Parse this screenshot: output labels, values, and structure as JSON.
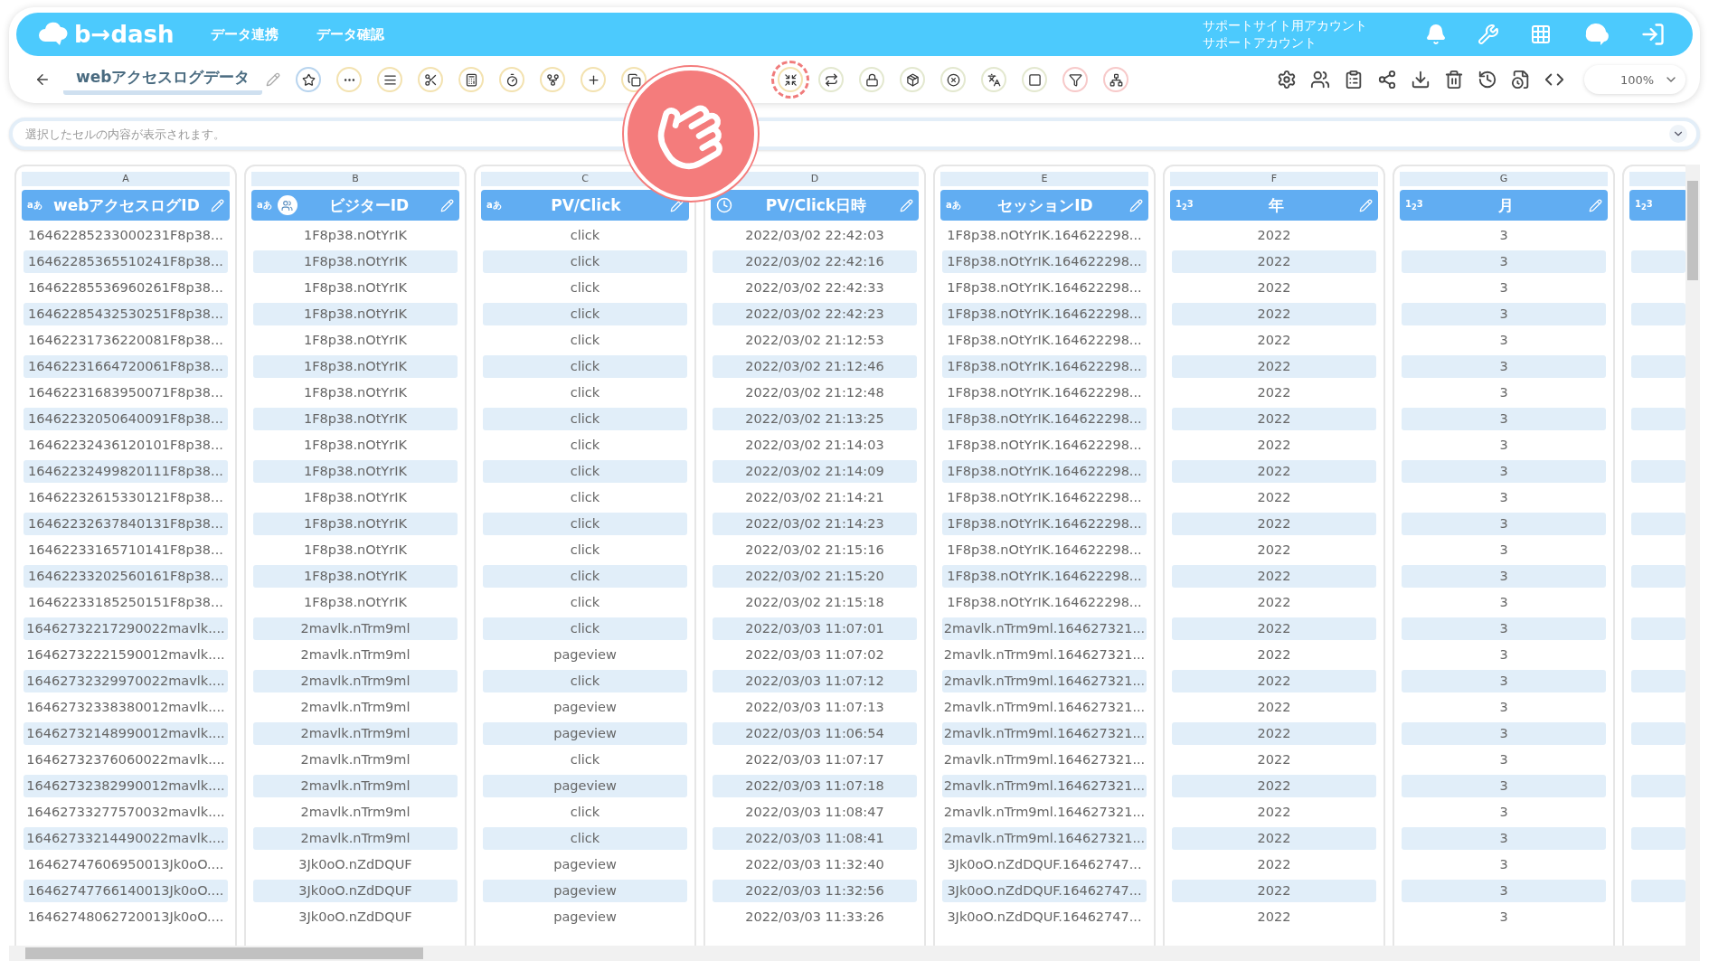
{
  "header": {
    "logo": "b→dash",
    "nav": [
      {
        "label": "データ連携"
      },
      {
        "label": "データ確認"
      }
    ],
    "account": [
      "サポートサイト用アカウント",
      "サポートアカウント"
    ]
  },
  "toolbar": {
    "title": "webアクセスログデータ",
    "tools": [
      {
        "color": "#b8d4ee",
        "highlighted": false
      },
      {
        "color": "#f3e2b0",
        "highlighted": false
      },
      {
        "color": "#f3e2b0",
        "highlighted": false
      },
      {
        "color": "#f3e2b0",
        "highlighted": false
      },
      {
        "color": "#f3e2b0",
        "highlighted": false
      },
      {
        "color": "#f3e2b0",
        "highlighted": false
      },
      {
        "color": "#f3e2b0",
        "highlighted": false
      },
      {
        "color": "#f3e2b0",
        "highlighted": false
      },
      {
        "color": "#f3e2b0",
        "highlighted": false
      },
      {
        "color": "#f3e2b0",
        "highlighted": true
      },
      {
        "color": "#e3e8cf",
        "highlighted": false
      },
      {
        "color": "#e3e8cf",
        "highlighted": false
      },
      {
        "color": "#e3e8cf",
        "highlighted": false
      },
      {
        "color": "#e3e8cf",
        "highlighted": false
      },
      {
        "color": "#e3e8cf",
        "highlighted": false
      },
      {
        "color": "#e3e8cf",
        "highlighted": false
      },
      {
        "color": "#f7c9c9",
        "highlighted": false
      },
      {
        "color": "#f7c9c9",
        "highlighted": false
      }
    ],
    "zoom": "100%"
  },
  "formula_bar": {
    "placeholder": "選択したセルの内容が表示されます。"
  },
  "table": {
    "columns": [
      {
        "letter": "A",
        "kind": "text",
        "badge": "aあ",
        "title": "webアクセスログID",
        "cells": [
          "16462285233000231F8p38...",
          "16462285365510241F8p38...",
          "16462285536960261F8p38...",
          "16462285432530251F8p38...",
          "16462231736220081F8p38...",
          "16462231664720061F8p38...",
          "16462231683950071F8p38...",
          "16462232050640091F8p38...",
          "16462232436120101F8p38...",
          "16462232499820111F8p38...",
          "16462232615330121F8p38...",
          "16462232637840131F8p38...",
          "16462233165710141F8p38...",
          "16462233202560161F8p38...",
          "16462233185250151F8p38...",
          "16462732217290022mavlk....",
          "16462732221590012mavlk....",
          "16462732329970022mavlk....",
          "16462732338380012mavlk....",
          "16462732148990012mavlk....",
          "16462732376060022mavlk....",
          "16462732382990012mavlk....",
          "16462733277570032mavlk....",
          "16462733214490022mavlk....",
          "16462747606950013Jk0oO....",
          "16462747766140013Jk0oO....",
          "16462748062720013Jk0oO...."
        ]
      },
      {
        "letter": "B",
        "kind": "text",
        "badge": "aあ",
        "linked": true,
        "title": "ビジターID",
        "cells": [
          "1F8p38.nOtYrIK",
          "1F8p38.nOtYrIK",
          "1F8p38.nOtYrIK",
          "1F8p38.nOtYrIK",
          "1F8p38.nOtYrIK",
          "1F8p38.nOtYrIK",
          "1F8p38.nOtYrIK",
          "1F8p38.nOtYrIK",
          "1F8p38.nOtYrIK",
          "1F8p38.nOtYrIK",
          "1F8p38.nOtYrIK",
          "1F8p38.nOtYrIK",
          "1F8p38.nOtYrIK",
          "1F8p38.nOtYrIK",
          "1F8p38.nOtYrIK",
          "2mavlk.nTrm9ml",
          "2mavlk.nTrm9ml",
          "2mavlk.nTrm9ml",
          "2mavlk.nTrm9ml",
          "2mavlk.nTrm9ml",
          "2mavlk.nTrm9ml",
          "2mavlk.nTrm9ml",
          "2mavlk.nTrm9ml",
          "2mavlk.nTrm9ml",
          "3Jk0oO.nZdDQUF",
          "3Jk0oO.nZdDQUF",
          "3Jk0oO.nZdDQUF"
        ]
      },
      {
        "letter": "C",
        "kind": "text",
        "badge": "aあ",
        "title": "PV/Click",
        "cells": [
          "click",
          "click",
          "click",
          "click",
          "click",
          "click",
          "click",
          "click",
          "click",
          "click",
          "click",
          "click",
          "click",
          "click",
          "click",
          "click",
          "pageview",
          "click",
          "pageview",
          "pageview",
          "click",
          "pageview",
          "click",
          "click",
          "pageview",
          "pageview",
          "pageview"
        ]
      },
      {
        "letter": "D",
        "kind": "datetime",
        "title": "PV/Click日時",
        "cells": [
          "2022/03/02 22:42:03",
          "2022/03/02 22:42:16",
          "2022/03/02 22:42:33",
          "2022/03/02 22:42:23",
          "2022/03/02 21:12:53",
          "2022/03/02 21:12:46",
          "2022/03/02 21:12:48",
          "2022/03/02 21:13:25",
          "2022/03/02 21:14:03",
          "2022/03/02 21:14:09",
          "2022/03/02 21:14:21",
          "2022/03/02 21:14:23",
          "2022/03/02 21:15:16",
          "2022/03/02 21:15:20",
          "2022/03/02 21:15:18",
          "2022/03/03 11:07:01",
          "2022/03/03 11:07:02",
          "2022/03/03 11:07:12",
          "2022/03/03 11:07:13",
          "2022/03/03 11:06:54",
          "2022/03/03 11:07:17",
          "2022/03/03 11:07:18",
          "2022/03/03 11:08:47",
          "2022/03/03 11:08:41",
          "2022/03/03 11:32:40",
          "2022/03/03 11:32:56",
          "2022/03/03 11:33:26"
        ]
      },
      {
        "letter": "E",
        "kind": "text",
        "badge": "aあ",
        "title": "セッションID",
        "cells": [
          "1F8p38.nOtYrIK.164622298...",
          "1F8p38.nOtYrIK.164622298...",
          "1F8p38.nOtYrIK.164622298...",
          "1F8p38.nOtYrIK.164622298...",
          "1F8p38.nOtYrIK.164622298...",
          "1F8p38.nOtYrIK.164622298...",
          "1F8p38.nOtYrIK.164622298...",
          "1F8p38.nOtYrIK.164622298...",
          "1F8p38.nOtYrIK.164622298...",
          "1F8p38.nOtYrIK.164622298...",
          "1F8p38.nOtYrIK.164622298...",
          "1F8p38.nOtYrIK.164622298...",
          "1F8p38.nOtYrIK.164622298...",
          "1F8p38.nOtYrIK.164622298...",
          "1F8p38.nOtYrIK.164622298...",
          "2mavlk.nTrm9ml.164627321...",
          "2mavlk.nTrm9ml.164627321...",
          "2mavlk.nTrm9ml.164627321...",
          "2mavlk.nTrm9ml.164627321...",
          "2mavlk.nTrm9ml.164627321...",
          "2mavlk.nTrm9ml.164627321...",
          "2mavlk.nTrm9ml.164627321...",
          "2mavlk.nTrm9ml.164627321...",
          "2mavlk.nTrm9ml.164627321...",
          "3Jk0oO.nZdDQUF.16462747...",
          "3Jk0oO.nZdDQUF.16462747...",
          "3Jk0oO.nZdDQUF.16462747..."
        ]
      },
      {
        "letter": "F",
        "kind": "number",
        "badge": "1$_{2}$3",
        "title": "年",
        "cells": [
          "2022",
          "2022",
          "2022",
          "2022",
          "2022",
          "2022",
          "2022",
          "2022",
          "2022",
          "2022",
          "2022",
          "2022",
          "2022",
          "2022",
          "2022",
          "2022",
          "2022",
          "2022",
          "2022",
          "2022",
          "2022",
          "2022",
          "2022",
          "2022",
          "2022",
          "2022",
          "2022"
        ]
      },
      {
        "letter": "G",
        "kind": "number",
        "badge": "1$_{2}$3",
        "title": "月",
        "cells": [
          "3",
          "3",
          "3",
          "3",
          "3",
          "3",
          "3",
          "3",
          "3",
          "3",
          "3",
          "3",
          "3",
          "3",
          "3",
          "3",
          "3",
          "3",
          "3",
          "3",
          "3",
          "3",
          "3",
          "3",
          "3",
          "3",
          "3"
        ]
      },
      {
        "kind": "number",
        "badge": "1$_{2}$3"
      }
    ]
  }
}
